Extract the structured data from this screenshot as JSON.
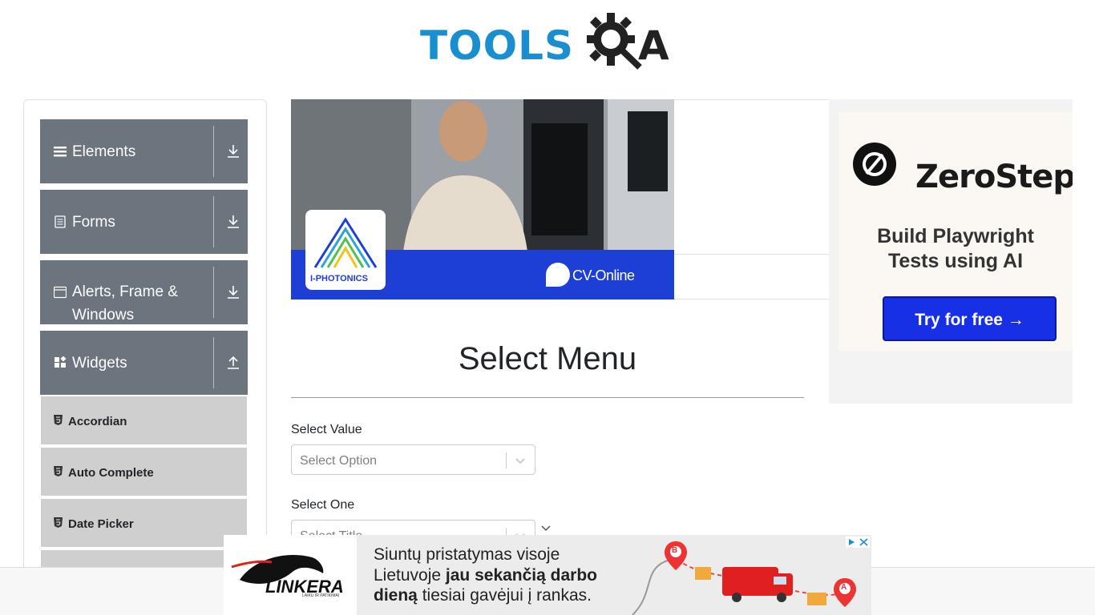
{
  "brand": {
    "logo_text": "TOOLS",
    "logo_a": "A"
  },
  "sidebar": {
    "groups": [
      {
        "label": "Elements",
        "icon": "list-icon",
        "toggle": "download-icon"
      },
      {
        "label": "Forms",
        "icon": "form-icon",
        "toggle": "download-icon"
      },
      {
        "label": "Alerts, Frame & Windows",
        "icon": "window-icon",
        "toggle": "download-icon"
      },
      {
        "label": "Widgets",
        "icon": "widgets-icon",
        "toggle": "upload-icon"
      }
    ],
    "items": [
      {
        "label": "Accordian"
      },
      {
        "label": "Auto Complete"
      },
      {
        "label": "Date Picker"
      }
    ]
  },
  "banner": {
    "brand1": "I-PHOTONICS",
    "brand2": "CV-Online"
  },
  "right_ad": {
    "title": "ZeroStep",
    "subtitle_line1": "Build Playwright",
    "subtitle_line2": "Tests using AI",
    "button": "Try for free →"
  },
  "main": {
    "title": "Select Menu",
    "fields": [
      {
        "label": "Select Value",
        "placeholder": "Select Option"
      },
      {
        "label": "Select One",
        "placeholder": "Select Title"
      }
    ]
  },
  "bottom_ad": {
    "logo": "LINKERA",
    "logo_sub": "LAIKU IR PATIKIMAI",
    "line1": "Siuntų pristatymas visoje",
    "line2_pre": "Lietuvoje ",
    "line2_bold": "jau sekančią darbo",
    "line3_bold": "dieną",
    "line3_post": " tiesiai gavėjui į rankas.",
    "pin_b": "B",
    "pin_a": "A"
  },
  "colors": {
    "accent": "#1a8fcf",
    "sidebar_header": "#6c757d",
    "menu_item": "#cfcfcf",
    "ad_button": "#1730e6"
  }
}
